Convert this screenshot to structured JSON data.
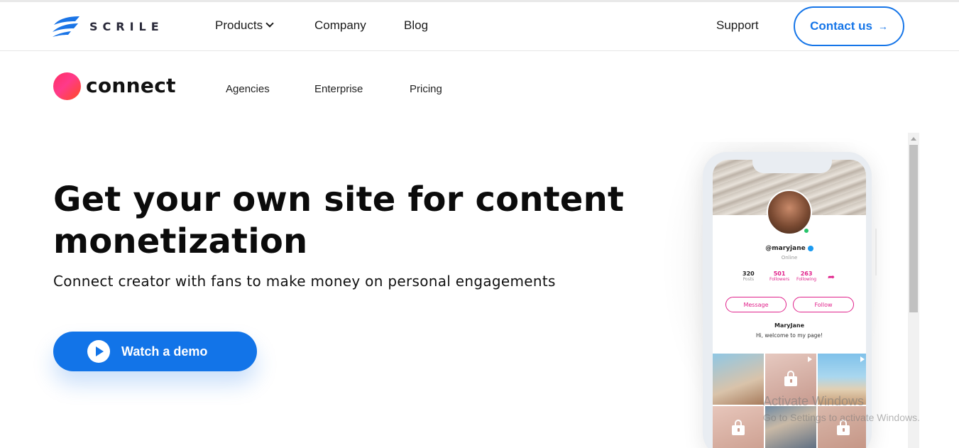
{
  "brand": {
    "name": "SCRILE"
  },
  "topnav": {
    "products": "Products",
    "company": "Company",
    "blog": "Blog",
    "support": "Support",
    "contact": "Contact us",
    "contact_arrow": "→"
  },
  "product": {
    "name": "connect",
    "subnav": {
      "agencies": "Agencies",
      "enterprise": "Enterprise",
      "pricing": "Pricing"
    }
  },
  "hero": {
    "title": "Get your own site for content monetization",
    "subtitle": "Connect creator with fans to make money on personal engagements",
    "cta": "Watch a demo"
  },
  "phone_profile": {
    "username": "@maryjane",
    "status": "Online",
    "posts_count": "320",
    "posts_label": "Posts",
    "followers_count": "501",
    "followers_label": "Followers",
    "following_count": "263",
    "following_label": "Following",
    "message_btn": "Message",
    "follow_btn": "Follow",
    "display_name": "MaryJane",
    "bio": "Hi, welcome to my page!",
    "share_icon": "➦"
  },
  "os_overlay": {
    "line1": "Activate Windows",
    "line2": "Go to Settings to activate Windows."
  },
  "colors": {
    "accent_blue": "#1274e8",
    "brand_pink": "#e0208a",
    "connect_gradient_start": "#ff2e62",
    "connect_gradient_end": "#ff4b1f"
  },
  "icons": {
    "brand_logo": "scrile-wave-logo",
    "chevron": "chevron-down-icon",
    "play": "play-icon",
    "lock": "lock-icon",
    "share": "share-icon",
    "verified": "verified-badge-icon"
  }
}
